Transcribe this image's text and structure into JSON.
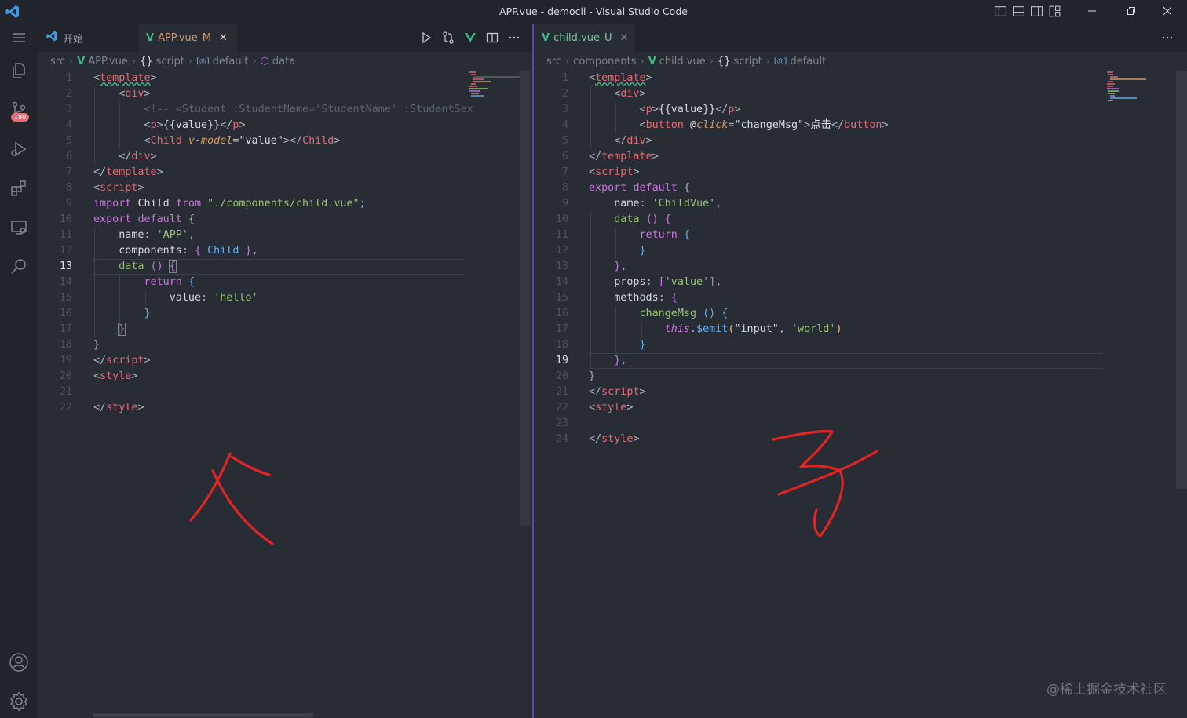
{
  "window": {
    "title": "APP.vue - democli - Visual Studio Code"
  },
  "activity_bar": {
    "source_control_badge": "180"
  },
  "left_editor": {
    "tabs": [
      {
        "label": "开始"
      },
      {
        "label": "APP.vue",
        "flag": "M"
      }
    ],
    "breadcrumb": [
      "src",
      "APP.vue",
      "script",
      "default",
      "data"
    ],
    "current_line": "13",
    "line_numbers": [
      "1",
      "2",
      "3",
      "4",
      "5",
      "6",
      "7",
      "8",
      "9",
      "10",
      "11",
      "12",
      "13",
      "14",
      "15",
      "16",
      "17",
      "18",
      "19",
      "20",
      "21",
      "22"
    ]
  },
  "right_editor": {
    "tabs": [
      {
        "label": "child.vue",
        "flag": "U"
      }
    ],
    "breadcrumb": [
      "src",
      "components",
      "child.vue",
      "script",
      "default"
    ],
    "current_line": "19",
    "line_numbers": [
      "1",
      "2",
      "3",
      "4",
      "5",
      "6",
      "7",
      "8",
      "9",
      "10",
      "11",
      "12",
      "13",
      "14",
      "15",
      "16",
      "17",
      "18",
      "19",
      "20",
      "21",
      "22",
      "23",
      "24"
    ]
  },
  "watermark": "@稀土掘金技术社区",
  "colors": {
    "editor_bg": "#282c34",
    "sidebar_bg": "#21252b",
    "annotation_red": "#e02424",
    "vue_green": "#41b883"
  }
}
